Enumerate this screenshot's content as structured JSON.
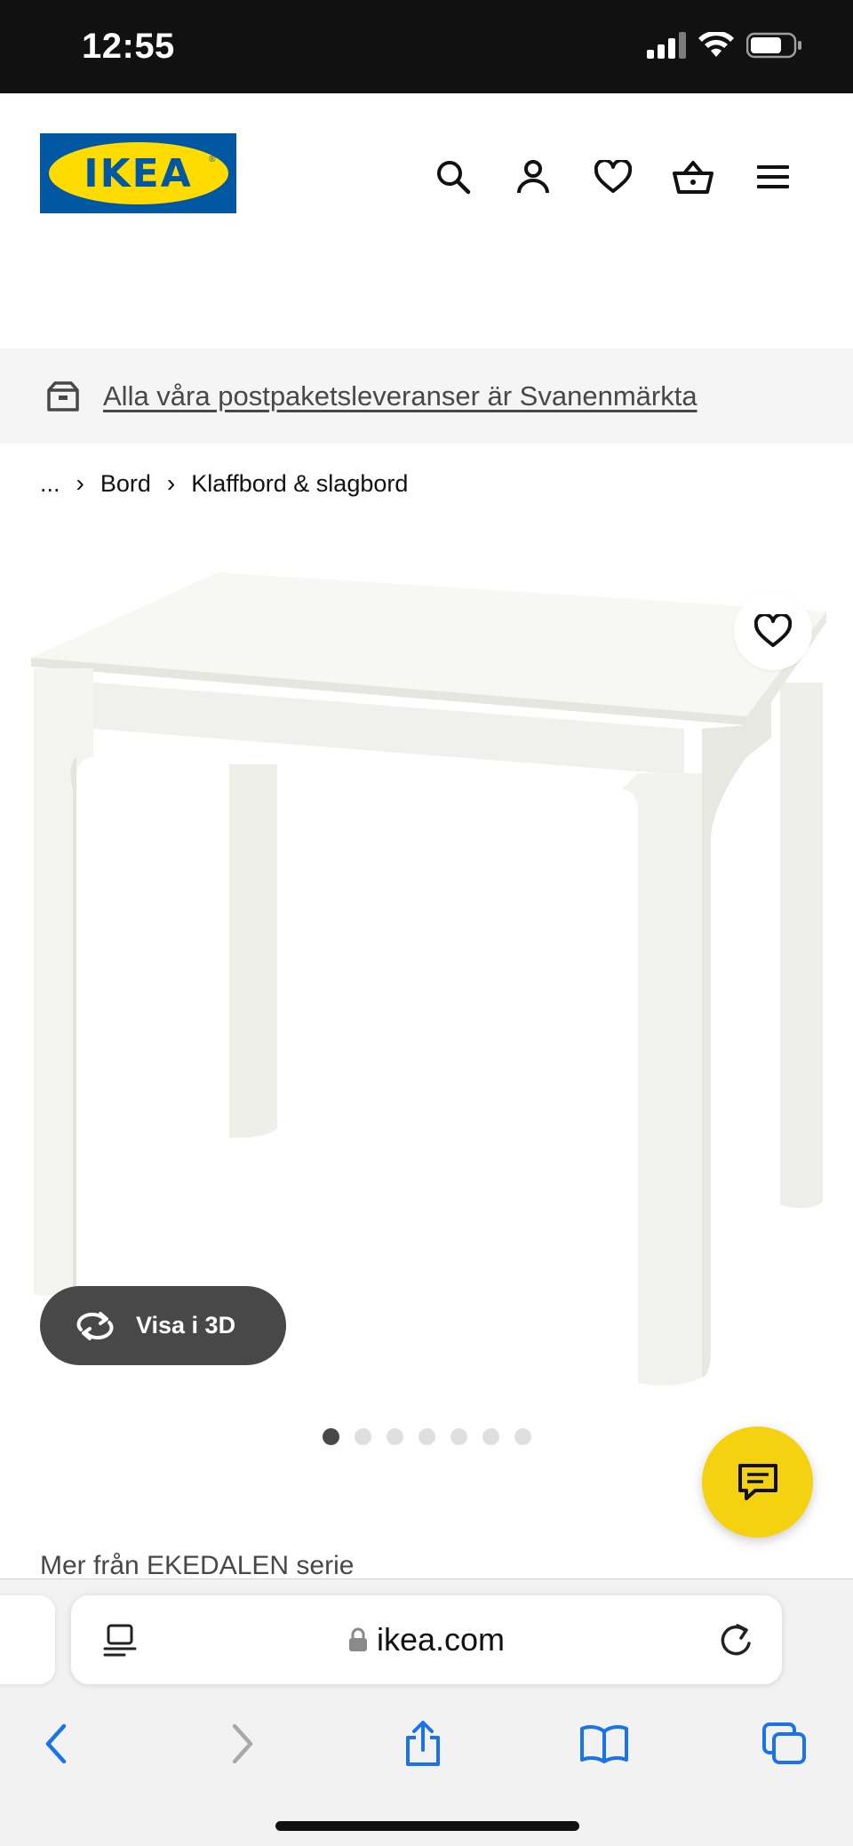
{
  "status_bar": {
    "time": "12:55"
  },
  "header": {
    "logo_text": "IKEA",
    "logo_reg": "®"
  },
  "banner": {
    "text": "Alla våra postpaketsleveranser är Svanenmärkta"
  },
  "breadcrumb": {
    "items": [
      "...",
      "Bord",
      "Klaffbord & slagbord"
    ],
    "separator": "›"
  },
  "product": {
    "view3d_label": "Visa i 3D",
    "carousel": {
      "count": 7,
      "active_index": 0
    },
    "series_text": "Mer från EKEDALEN serie"
  },
  "browser": {
    "url": "ikea.com"
  },
  "colors": {
    "ikea_blue": "#0058a3",
    "ikea_yellow": "#ffdb00",
    "chat_yellow": "#f5d20f",
    "safari_blue": "#1a73e8"
  }
}
